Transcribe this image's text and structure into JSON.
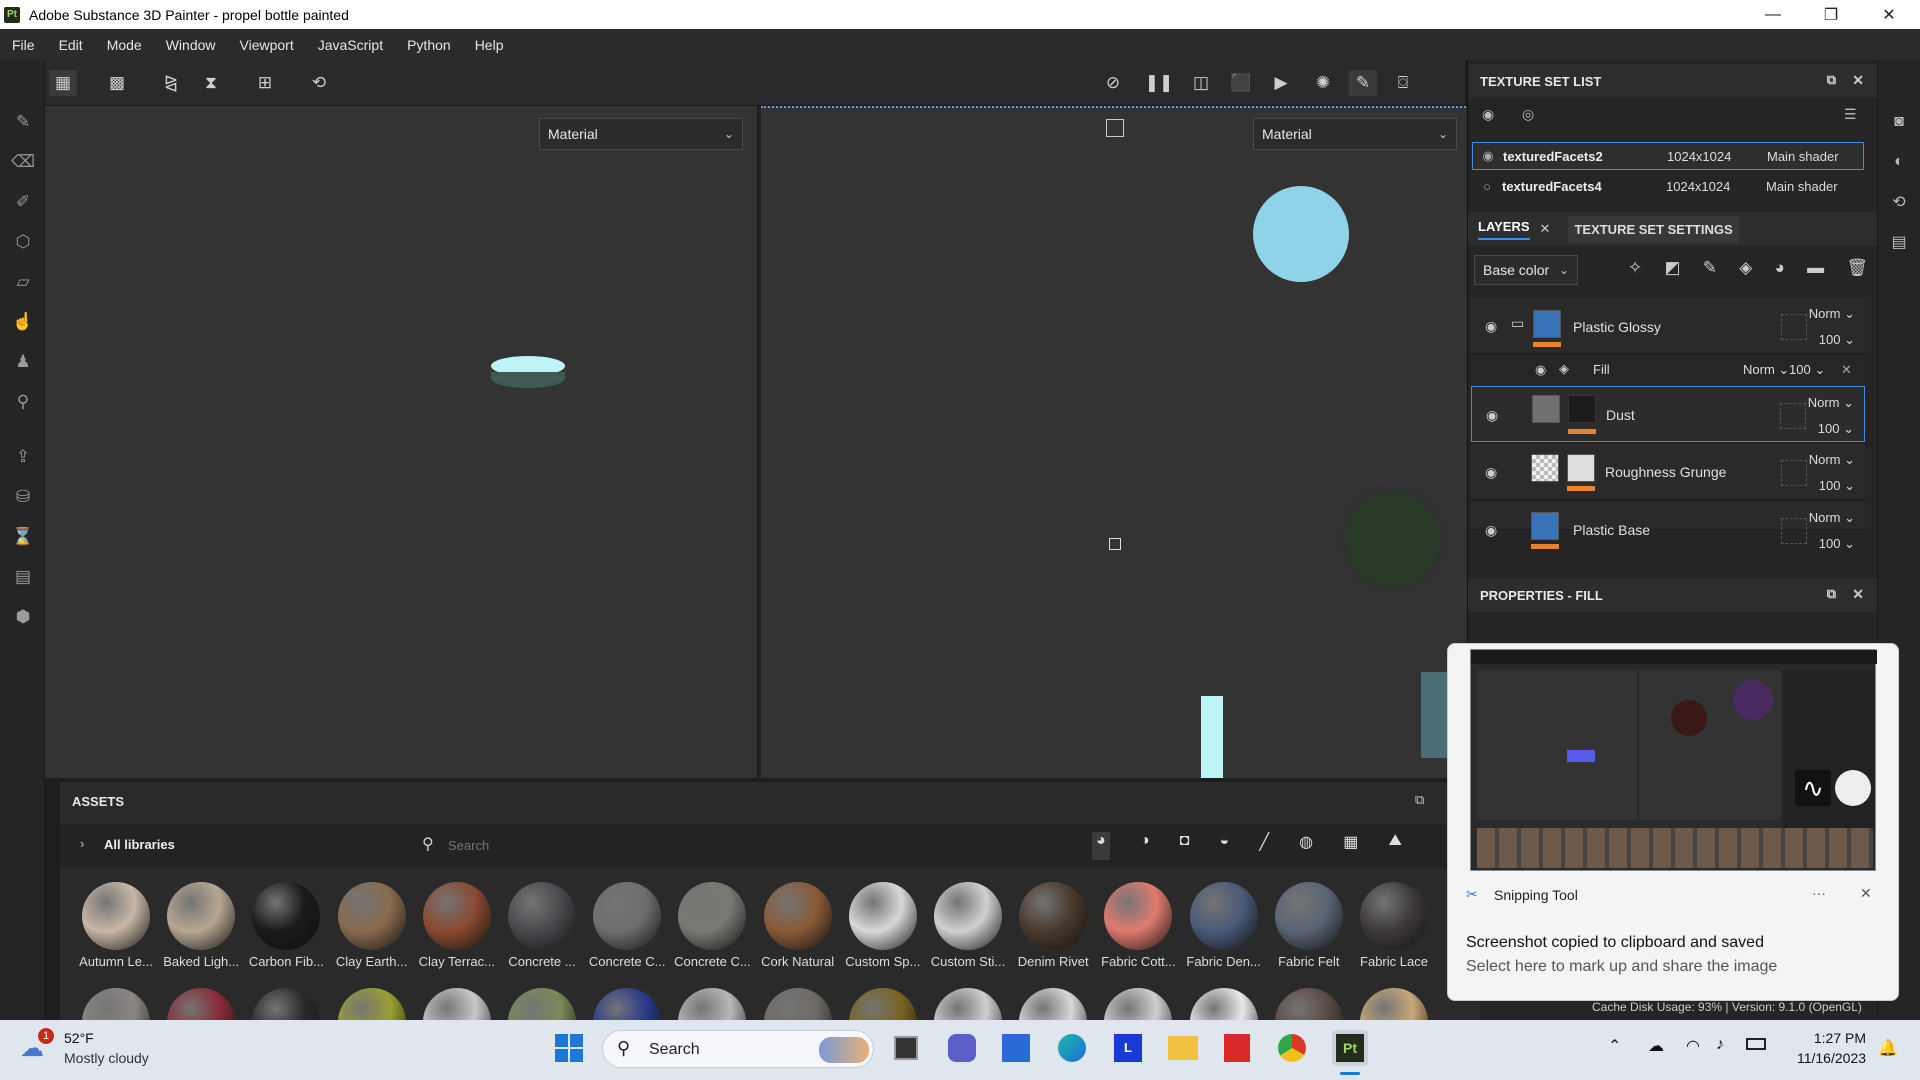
{
  "window": {
    "app_icon": "Pt",
    "title": "Adobe Substance 3D Painter - propel bottle painted",
    "minimize": "—",
    "restore": "❐",
    "close": "✕"
  },
  "menu": [
    "File",
    "Edit",
    "Mode",
    "Window",
    "Viewport",
    "JavaScript",
    "Python",
    "Help"
  ],
  "viewport": {
    "left_dropdown": "Material",
    "right_dropdown": "Material"
  },
  "texture_set_list": {
    "title": "TEXTURE SET LIST",
    "rows": [
      {
        "name": "texturedFacets2",
        "resolution": "1024x1024",
        "shader": "Main shader"
      },
      {
        "name": "texturedFacets4",
        "resolution": "1024x1024",
        "shader": "Main shader"
      }
    ]
  },
  "layers_panel": {
    "tab_layers": "LAYERS",
    "tab_settings": "TEXTURE SET SETTINGS",
    "channel": "Base color",
    "layers": [
      {
        "name": "Plastic Glossy",
        "blend": "Norm",
        "opacity": "100"
      },
      {
        "name": "Fill",
        "blend": "Norm",
        "opacity": "100"
      },
      {
        "name": "Dust",
        "blend": "Norm",
        "opacity": "100"
      },
      {
        "name": "Roughness Grunge",
        "blend": "Norm",
        "opacity": "100"
      },
      {
        "name": "Plastic Base",
        "blend": "Norm",
        "opacity": "100"
      }
    ]
  },
  "properties": {
    "title": "PROPERTIES - FILL"
  },
  "assets": {
    "title": "ASSETS",
    "library": "All libraries",
    "search_placeholder": "Search",
    "items": [
      {
        "label": "Autumn Le...",
        "color": "#c9b7a8"
      },
      {
        "label": "Baked Ligh...",
        "color": "#b7a792"
      },
      {
        "label": "Carbon Fib...",
        "color": "#1a1a1a"
      },
      {
        "label": "Clay Earth...",
        "color": "#8a6a4e"
      },
      {
        "label": "Clay Terrac...",
        "color": "#8a4a32"
      },
      {
        "label": "Concrete ...",
        "color": "#4a4a4e"
      },
      {
        "label": "Concrete C...",
        "color": "#6e6e6e"
      },
      {
        "label": "Concrete C...",
        "color": "#7a7872"
      },
      {
        "label": "Cork Natural",
        "color": "#8a5a38"
      },
      {
        "label": "Custom Sp...",
        "color": "#d8d8d8"
      },
      {
        "label": "Custom Sti...",
        "color": "#d0d0d0"
      },
      {
        "label": "Denim Rivet",
        "color": "#4a3a2e"
      },
      {
        "label": "Fabric Cott...",
        "color": "#e07a70"
      },
      {
        "label": "Fabric Den...",
        "color": "#4a5a78"
      },
      {
        "label": "Fabric Felt",
        "color": "#5a6474"
      },
      {
        "label": "Fabric Lace",
        "color": "#3e3a3a"
      }
    ],
    "row2_colors": [
      "#8a8684",
      "#8a2a38",
      "#2a2a2a",
      "#9aa030",
      "#c8c8c8",
      "#7a8a58",
      "#2a3a8a",
      "#b8b8b8",
      "#6e6a66",
      "#7a6420",
      "#cfcfcf",
      "#d8d8d8",
      "#cfcfcf",
      "#e8e8e8",
      "#5a4a44",
      "#c8a878"
    ]
  },
  "status_bar": "Cache Disk Usage:  93% | Version: 9.1.0 (OpenGL)",
  "snipping": {
    "app": "Snipping Tool",
    "more": "···",
    "headline": "Screenshot copied to clipboard and saved",
    "sub": "Select here to mark up and share the image"
  },
  "taskbar": {
    "weather_badge": "1",
    "temp": "52°F",
    "condition": "Mostly cloudy",
    "search_placeholder": "Search",
    "time": "1:27 PM",
    "date": "11/16/2023"
  }
}
